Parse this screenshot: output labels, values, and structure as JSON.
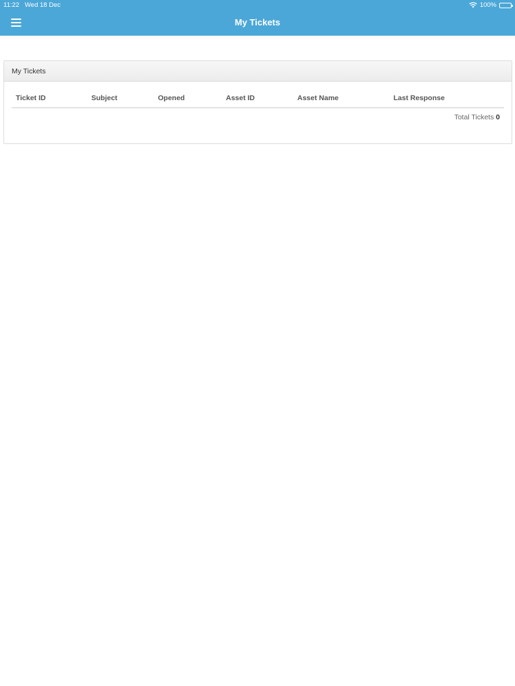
{
  "status_bar": {
    "time": "11:22",
    "date": "Wed 18 Dec",
    "battery": "100%",
    "battery_level": 1.0
  },
  "header": {
    "title": "My Tickets",
    "menu_icon": "hamburger-menu-icon",
    "background_color": "#4ba7d7"
  },
  "panel": {
    "title": "My Tickets",
    "columns": [
      "Ticket ID",
      "Subject",
      "Opened",
      "Asset ID",
      "Asset Name",
      "Last Response"
    ],
    "rows": [],
    "total_label": "Total Tickets",
    "total_value": "0"
  }
}
